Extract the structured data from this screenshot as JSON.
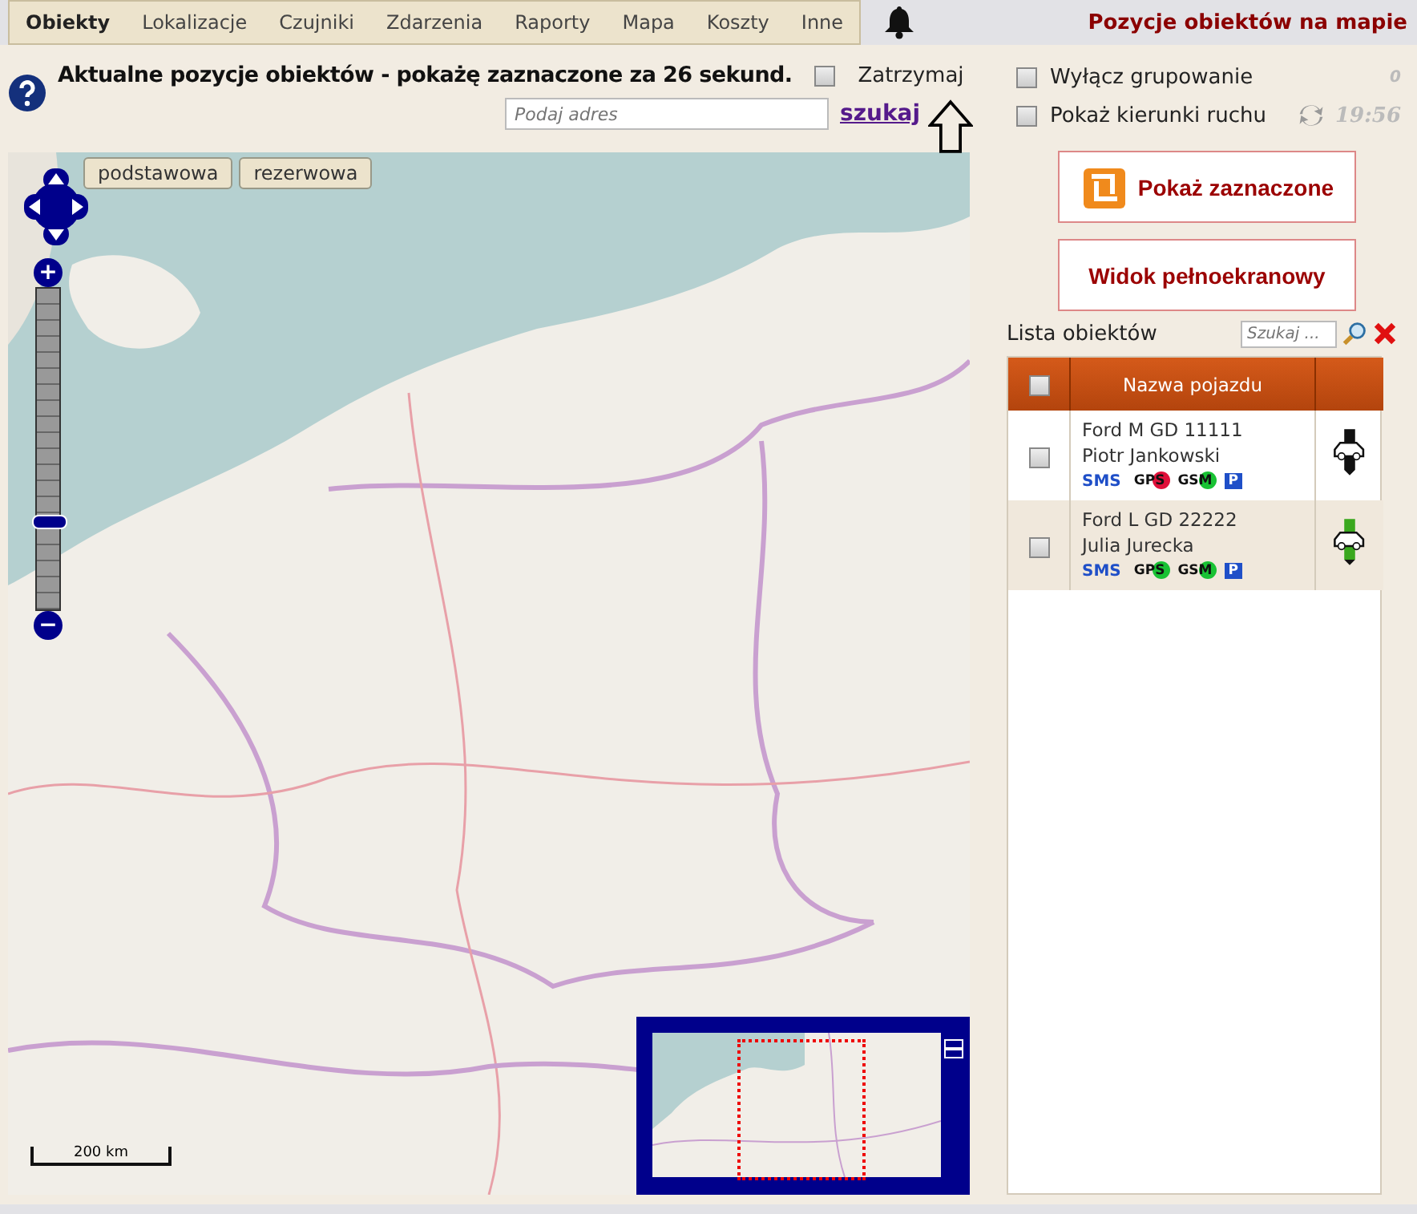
{
  "nav": {
    "items": [
      {
        "label": "Obiekty",
        "selected": true
      },
      {
        "label": "Lokalizacje",
        "selected": false
      },
      {
        "label": "Czujniki",
        "selected": false
      },
      {
        "label": "Zdarzenia",
        "selected": false
      },
      {
        "label": "Raporty",
        "selected": false
      },
      {
        "label": "Mapa",
        "selected": false
      },
      {
        "label": "Koszty",
        "selected": false
      },
      {
        "label": "Inne",
        "selected": false
      }
    ]
  },
  "page_title": "Pozycje obiektów na mapie",
  "heading": "Aktualne pozycje obiektów - pokażę zaznaczone za 26 sekund.",
  "stop": {
    "label": "Zatrzymaj",
    "checked": false
  },
  "address": {
    "placeholder": "Podaj adres"
  },
  "search_link": "szukaj",
  "map": {
    "layers": [
      "podstawowa",
      "rezerwowa"
    ],
    "scale": "200 km",
    "zoom_in": "+",
    "zoom_out": "−",
    "zoom": {
      "level": 0.27
    }
  },
  "options": [
    {
      "label": "Wyłącz grupowanie",
      "checked": false
    },
    {
      "label": "Pokaż kierunki ruchu",
      "checked": false
    }
  ],
  "counter": "0",
  "time": "19:56",
  "buttons": [
    {
      "label": "Pokaż zaznaczone",
      "kind": "icon"
    },
    {
      "label": "Widok pełnoekranowy",
      "kind": "plain"
    }
  ],
  "list": {
    "title": "Lista obiektów",
    "search_placeholder": "Szukaj ...",
    "all_checked": false,
    "column": "Nazwa pojazdu",
    "rows": [
      {
        "name": "Ford M GD 11111",
        "driver": "Piotr Jankowski",
        "checked": false,
        "sms": "SMS",
        "gps": {
          "label": "GPS",
          "color": "#e0103a"
        },
        "gsm": {
          "label": "GSM",
          "color": "#19c234"
        },
        "parking": "P",
        "marker": {
          "color": "#111111"
        }
      },
      {
        "name": "Ford L GD 22222",
        "driver": "Julia Jurecka",
        "checked": false,
        "sms": "SMS",
        "gps": {
          "label": "GPS",
          "color": "#19c234"
        },
        "gsm": {
          "label": "GSM",
          "color": "#19c234"
        },
        "parking": "P",
        "marker": {
          "color": "#3aa81e"
        }
      }
    ]
  }
}
